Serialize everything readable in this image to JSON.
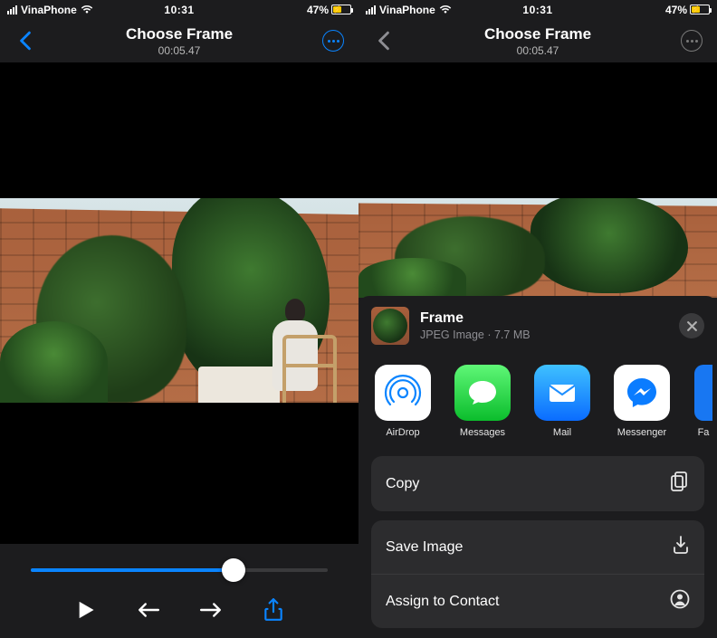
{
  "status": {
    "carrier": "VinaPhone",
    "time": "10:31",
    "battery_pct": "47%"
  },
  "nav": {
    "title": "Choose Frame",
    "timestamp": "00:05.47"
  },
  "left_screen": {
    "slider": {
      "progress_pct": 63
    }
  },
  "share_sheet": {
    "item_title": "Frame",
    "item_subtitle": "JPEG Image · 7.7 MB",
    "apps": [
      {
        "key": "airdrop",
        "label": "AirDrop"
      },
      {
        "key": "messages",
        "label": "Messages"
      },
      {
        "key": "mail",
        "label": "Mail"
      },
      {
        "key": "messenger",
        "label": "Messenger"
      },
      {
        "key": "facebook",
        "label": "Fa"
      }
    ],
    "actions_primary": [
      {
        "key": "copy",
        "label": "Copy"
      }
    ],
    "actions_secondary": [
      {
        "key": "save-image",
        "label": "Save Image"
      },
      {
        "key": "assign-contact",
        "label": "Assign to Contact"
      }
    ]
  }
}
